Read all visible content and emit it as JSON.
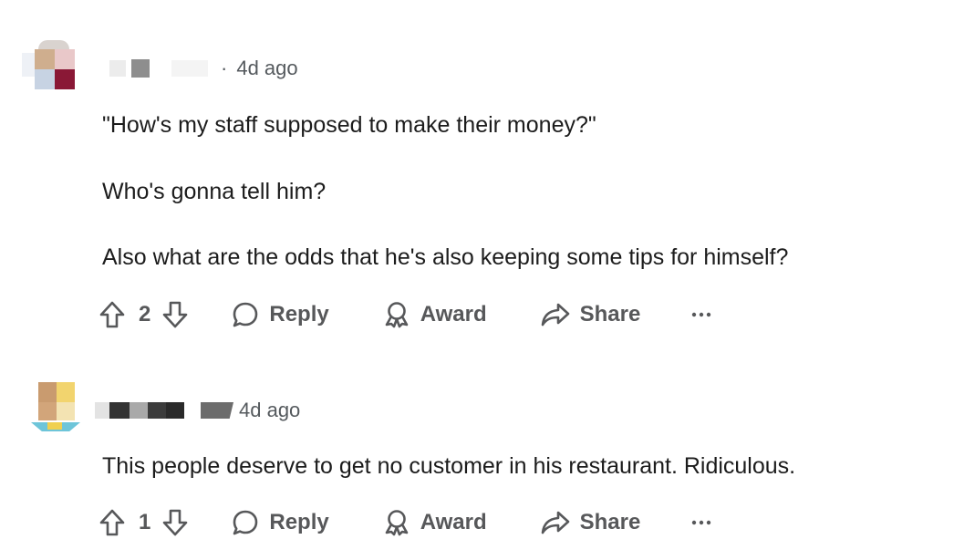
{
  "comments": [
    {
      "timestamp": "4d ago",
      "separator": "·",
      "paragraphs": [
        "\"How's my staff supposed to make their money?\"",
        "Who's gonna tell him?",
        "Also what are the odds that he's also keeping some tips for himself?"
      ],
      "votes": "2",
      "reply_label": "Reply",
      "award_label": "Award",
      "share_label": "Share"
    },
    {
      "timestamp": "4d ago",
      "paragraphs": [
        "This people deserve to get no customer in his restaurant. Ridiculous."
      ],
      "votes": "1",
      "reply_label": "Reply",
      "award_label": "Award",
      "share_label": "Share"
    }
  ],
  "icons": {
    "upvote": "arrow-up-outline",
    "downvote": "arrow-down-outline",
    "reply": "speech-bubble-outline",
    "award": "ribbon-outline",
    "share": "share-arrow-outline",
    "more": "ellipsis"
  },
  "colors": {
    "text": "#1c1c1c",
    "meta": "#555a5e",
    "action": "#57585a"
  }
}
